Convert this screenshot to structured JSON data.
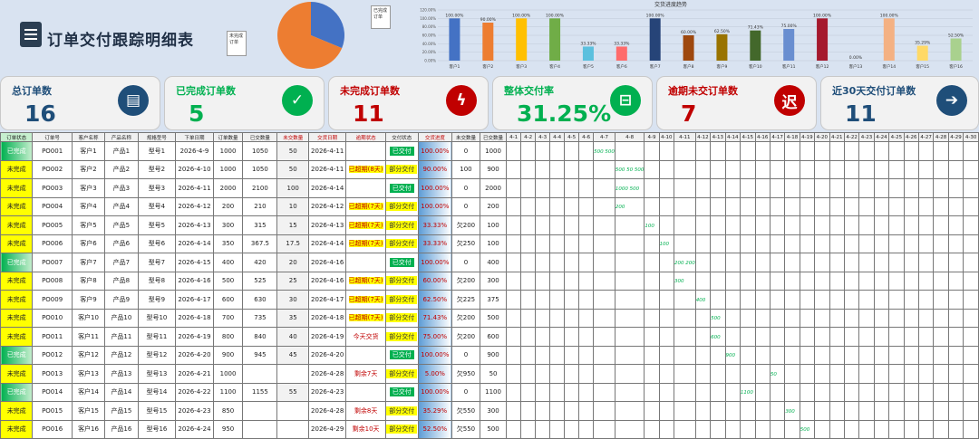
{
  "title": "订单交付跟踪明细表",
  "pie": {
    "callouts": [
      "已完成订单",
      "未完成订单"
    ],
    "values": [
      5,
      11
    ]
  },
  "bar": {
    "title": "交货进度趋势",
    "y_ticks": [
      "120.00%",
      "100.00%",
      "80.00%",
      "60.00%",
      "40.00%",
      "20.00%",
      "0.00%"
    ],
    "categories": [
      "客户1",
      "客户2",
      "客户3",
      "客户4",
      "客户5",
      "客户6",
      "客户7",
      "客户8",
      "客户9",
      "客户10",
      "客户11",
      "客户12",
      "客户13",
      "客户14",
      "客户15",
      "客户16"
    ],
    "values": [
      100,
      90,
      100,
      100,
      33.33,
      33.33,
      100,
      60,
      62.5,
      71.43,
      75,
      100,
      0,
      100,
      35.29,
      52.5
    ],
    "labels": [
      "100.00%",
      "90.00%",
      "100.00%",
      "100.00%",
      "33.33%",
      "33.33%",
      "100.00%",
      "60.00%",
      "62.50%",
      "71.43%",
      "75.00%",
      "100.00%",
      "0.00%",
      "100.00%",
      "35.29%",
      "52.50%"
    ],
    "colors": [
      "#4472c4",
      "#ed7d31",
      "#ffc000",
      "#70ad47",
      "#5bc0de",
      "#ff6b6b",
      "#264478",
      "#9e480e",
      "#997300",
      "#43682b",
      "#698ed0",
      "#a5192e",
      "#0070c0",
      "#f4b183",
      "#ffd966",
      "#a9d18e"
    ]
  },
  "kpis": [
    {
      "label": "总订单数",
      "value": "16",
      "icon": "clipboard-icon",
      "color": "#1f4e79",
      "bg": "#1f4e79",
      "glyph": "▤"
    },
    {
      "label": "已完成订单数",
      "value": "5",
      "icon": "check-icon",
      "color": "#00b050",
      "bg": "#00b050",
      "glyph": "✓"
    },
    {
      "label": "未完成订单数",
      "value": "11",
      "icon": "lightning-icon",
      "color": "#c00000",
      "bg": "#c00000",
      "glyph": "ϟ"
    },
    {
      "label": "整体交付率",
      "value": "31.25%",
      "icon": "delivery-icon",
      "color": "#00b050",
      "bg": "#00b050",
      "glyph": "⊟"
    },
    {
      "label": "逾期未交订单数",
      "value": "7",
      "icon": "overdue-icon",
      "color": "#c00000",
      "bg": "#c00000",
      "glyph": "迟"
    },
    {
      "label": "近30天交付订单数",
      "value": "11",
      "icon": "arrow-right-icon",
      "color": "#1f4e79",
      "bg": "#1f4e79",
      "glyph": "➔"
    }
  ],
  "columns": [
    "订单状态",
    "订单号",
    "客户名称",
    "产品名称",
    "规格型号",
    "下单日期",
    "订单数量",
    "已交数量",
    "未交数量",
    "交货日期",
    "逾期状态",
    "交付状态",
    "交货进度",
    "未交数量",
    "已交数量"
  ],
  "date_cols": [
    "4-1",
    "4-2",
    "4-3",
    "4-4",
    "4-5",
    "4-6",
    "4-7",
    "4-8",
    "4-9",
    "4-10",
    "4-11",
    "4-12",
    "4-13",
    "4-14",
    "4-15",
    "4-16",
    "4-17",
    "4-18",
    "4-19",
    "4-20",
    "4-21",
    "4-22",
    "4-23",
    "4-24",
    "4-25",
    "4-26",
    "4-27",
    "4-28",
    "4-29",
    "4-30"
  ],
  "rows": [
    {
      "status": "已完成",
      "id": "PO001",
      "cust": "客户1",
      "prod": "产品1",
      "spec": "型号1",
      "od": "2026-4-9",
      "qty": "1000",
      "done": "1050",
      "left": "50",
      "dd": "2026-4-11",
      "over": "",
      "deliv": "已交付",
      "rate": "100.00%",
      "un": "0",
      "dn": "1000",
      "gantt": "500  500",
      "gc": 21
    },
    {
      "status": "未完成",
      "id": "PO002",
      "cust": "客户2",
      "prod": "产品2",
      "spec": "型号2",
      "od": "2026-4-10",
      "qty": "1000",
      "done": "1050",
      "left": "50",
      "dd": "2026-4-11",
      "over": "已超期(8天)",
      "deliv": "部分交付",
      "rate": "90.00%",
      "un": "100",
      "dn": "900",
      "gantt": "500  50     500",
      "gc": 22
    },
    {
      "status": "未完成",
      "id": "PO003",
      "cust": "客户3",
      "prod": "产品3",
      "spec": "型号3",
      "od": "2026-4-11",
      "qty": "2000",
      "done": "2100",
      "left": "100",
      "dd": "2026-4-14",
      "over": "",
      "deliv": "已交付",
      "rate": "100.00%",
      "un": "0",
      "dn": "2000",
      "gantt": "1000  500",
      "gc": 22
    },
    {
      "status": "未完成",
      "id": "PO004",
      "cust": "客户4",
      "prod": "产品4",
      "spec": "型号4",
      "od": "2026-4-12",
      "qty": "200",
      "done": "210",
      "left": "10",
      "dd": "2026-4-12",
      "over": "已超期(7天)",
      "deliv": "部分交付",
      "rate": "100.00%",
      "un": "0",
      "dn": "200",
      "gantt": "200",
      "gc": 22
    },
    {
      "status": "未完成",
      "id": "PO005",
      "cust": "客户5",
      "prod": "产品5",
      "spec": "型号5",
      "od": "2026-4-13",
      "qty": "300",
      "done": "315",
      "left": "15",
      "dd": "2026-4-13",
      "over": "已超期(7天)",
      "deliv": "部分交付",
      "rate": "33.33%",
      "un": "欠200",
      "dn": "100",
      "gantt": "100",
      "gc": 23
    },
    {
      "status": "未完成",
      "id": "PO006",
      "cust": "客户6",
      "prod": "产品6",
      "spec": "型号6",
      "od": "2026-4-14",
      "qty": "350",
      "done": "367.5",
      "left": "17.5",
      "dd": "2026-4-14",
      "over": "已超期(7天)",
      "deliv": "部分交付",
      "rate": "33.33%",
      "un": "欠250",
      "dn": "100",
      "gantt": "100",
      "gc": 24
    },
    {
      "status": "已完成",
      "id": "PO007",
      "cust": "客户7",
      "prod": "产品7",
      "spec": "型号7",
      "od": "2026-4-15",
      "qty": "400",
      "done": "420",
      "left": "20",
      "dd": "2026-4-16",
      "over": "",
      "deliv": "已交付",
      "rate": "100.00%",
      "un": "0",
      "dn": "400",
      "gantt": "200  200",
      "gc": 25
    },
    {
      "status": "未完成",
      "id": "PO008",
      "cust": "客户8",
      "prod": "产品8",
      "spec": "型号8",
      "od": "2026-4-16",
      "qty": "500",
      "done": "525",
      "left": "25",
      "dd": "2026-4-16",
      "over": "已超期(7天)",
      "deliv": "部分交付",
      "rate": "60.00%",
      "un": "欠200",
      "dn": "300",
      "gantt": "300",
      "gc": 25
    },
    {
      "status": "未完成",
      "id": "PO009",
      "cust": "客户9",
      "prod": "产品9",
      "spec": "型号9",
      "od": "2026-4-17",
      "qty": "600",
      "done": "630",
      "left": "30",
      "dd": "2026-4-17",
      "over": "已超期(7天)",
      "deliv": "部分交付",
      "rate": "62.50%",
      "un": "欠225",
      "dn": "375",
      "gantt": "400",
      "gc": 26
    },
    {
      "status": "未完成",
      "id": "PO010",
      "cust": "客户10",
      "prod": "产品10",
      "spec": "型号10",
      "od": "2026-4-18",
      "qty": "700",
      "done": "735",
      "left": "35",
      "dd": "2026-4-18",
      "over": "已超期(7天)",
      "deliv": "部分交付",
      "rate": "71.43%",
      "un": "欠200",
      "dn": "500",
      "gantt": "500",
      "gc": 27
    },
    {
      "status": "未完成",
      "id": "PO011",
      "cust": "客户11",
      "prod": "产品11",
      "spec": "型号11",
      "od": "2026-4-19",
      "qty": "800",
      "done": "840",
      "left": "40",
      "dd": "2026-4-19",
      "over": "今天交货",
      "deliv": "部分交付",
      "rate": "75.00%",
      "un": "欠200",
      "dn": "600",
      "gantt": "600",
      "gc": 27
    },
    {
      "status": "已完成",
      "id": "PO012",
      "cust": "客户12",
      "prod": "产品12",
      "spec": "型号12",
      "od": "2026-4-20",
      "qty": "900",
      "done": "945",
      "left": "45",
      "dd": "2026-4-20",
      "over": "",
      "deliv": "已交付",
      "rate": "100.00%",
      "un": "0",
      "dn": "900",
      "gantt": "900",
      "gc": 28
    },
    {
      "status": "未完成",
      "id": "PO013",
      "cust": "客户13",
      "prod": "产品13",
      "spec": "型号13",
      "od": "2026-4-21",
      "qty": "1000",
      "done": "",
      "left": "",
      "dd": "2026-4-28",
      "over": "剩余7天",
      "deliv": "部分交付",
      "rate": "5.00%",
      "un": "欠950",
      "dn": "50",
      "gantt": "50",
      "gc": 31
    },
    {
      "status": "已完成",
      "id": "PO014",
      "cust": "客户14",
      "prod": "产品14",
      "spec": "型号14",
      "od": "2026-4-22",
      "qty": "1100",
      "done": "1155",
      "left": "55",
      "dd": "2026-4-23",
      "over": "",
      "deliv": "已交付",
      "rate": "100.00%",
      "un": "0",
      "dn": "1100",
      "gantt": "1100",
      "gc": 29
    },
    {
      "status": "未完成",
      "id": "PO015",
      "cust": "客户15",
      "prod": "产品15",
      "spec": "型号15",
      "od": "2026-4-23",
      "qty": "850",
      "done": "",
      "left": "",
      "dd": "2026-4-28",
      "over": "剩余8天",
      "deliv": "部分交付",
      "rate": "35.29%",
      "un": "欠550",
      "dn": "300",
      "gantt": "300",
      "gc": 32
    },
    {
      "status": "未完成",
      "id": "PO016",
      "cust": "客户16",
      "prod": "产品16",
      "spec": "型号16",
      "od": "2026-4-24",
      "qty": "950",
      "done": "",
      "left": "",
      "dd": "2026-4-29",
      "over": "剩余10天",
      "deliv": "部分交付",
      "rate": "52.50%",
      "un": "欠550",
      "dn": "500",
      "gantt": "500",
      "gc": 33
    }
  ]
}
